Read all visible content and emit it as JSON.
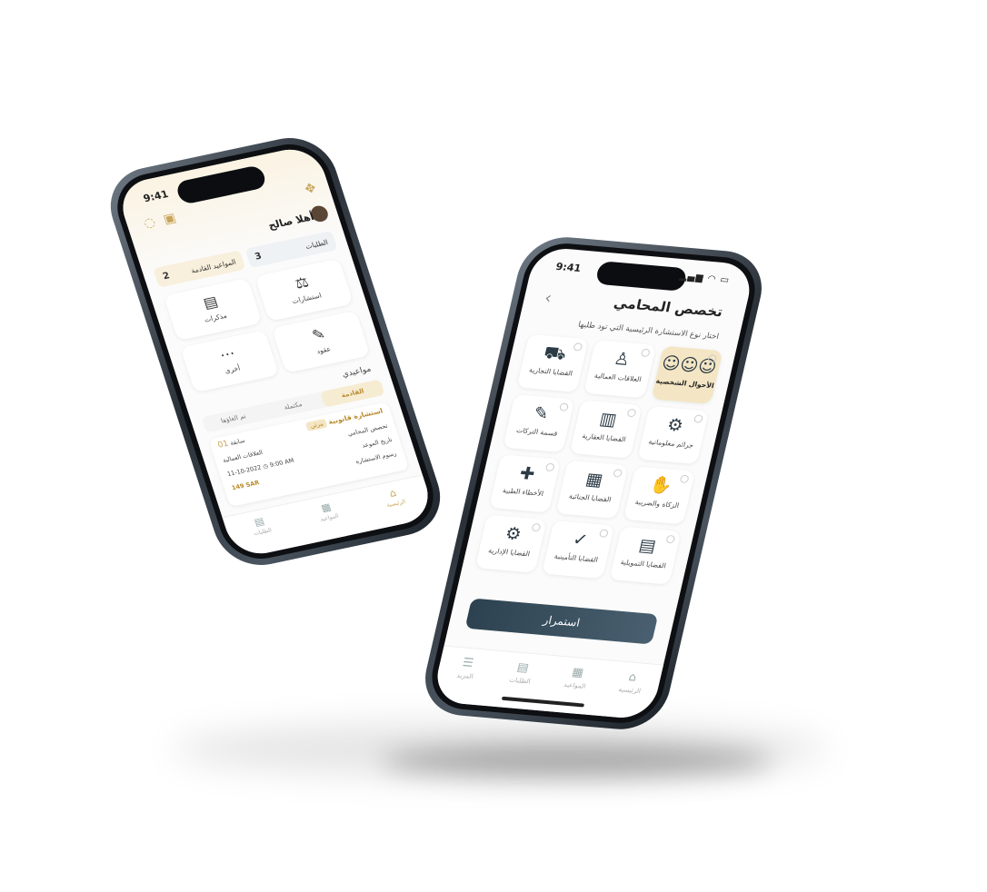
{
  "phone_b": {
    "time": "9:41",
    "status_icons": "▂▄▆ ◠ ▭",
    "title": "تخصص المحامي",
    "subtitle": "اختار نوع الاستشارة الرئيسية التي تود طلبها",
    "categories": [
      {
        "label": "الأحوال الشخصية",
        "selected": true,
        "icon": "family-icon"
      },
      {
        "label": "العلاقات العمالية",
        "selected": false,
        "icon": "worker-icon"
      },
      {
        "label": "القضايا التجارية",
        "selected": false,
        "icon": "commerce-icon"
      },
      {
        "label": "جرائم معلوماتية",
        "selected": false,
        "icon": "cyber-icon"
      },
      {
        "label": "القضايا العقارية",
        "selected": false,
        "icon": "building-icon"
      },
      {
        "label": "قسمة التركات",
        "selected": false,
        "icon": "document-icon"
      },
      {
        "label": "الزكاة والضريبة",
        "selected": false,
        "icon": "hand-coin-icon"
      },
      {
        "label": "القضايا الجنائية",
        "selected": false,
        "icon": "jail-icon"
      },
      {
        "label": "الأخطاء الطبية",
        "selected": false,
        "icon": "medical-icon"
      },
      {
        "label": "القضايا التمويلية",
        "selected": false,
        "icon": "finance-icon"
      },
      {
        "label": "القضايا التأمينية",
        "selected": false,
        "icon": "insurance-icon"
      },
      {
        "label": "القضايا الإدارية",
        "selected": false,
        "icon": "admin-gear-icon"
      }
    ],
    "continue_label": "استمرار",
    "tabs": [
      {
        "label": "المزيد",
        "icon": "menu-icon"
      },
      {
        "label": "الطلبات",
        "icon": "orders-icon"
      },
      {
        "label": "المواعيد",
        "icon": "calendar-icon"
      },
      {
        "label": "الرئيسية",
        "icon": "home-icon"
      }
    ]
  },
  "phone_a": {
    "time": "9:41",
    "greeting": "أهلا صالح",
    "counters": [
      {
        "label": "الطلبات",
        "value": "3"
      },
      {
        "label": "المواعيد القادمة",
        "value": "2"
      }
    ],
    "services": [
      {
        "label": "استشارات",
        "icon": "consult-icon"
      },
      {
        "label": "مذكرات",
        "icon": "memo-icon"
      },
      {
        "label": "عقود",
        "icon": "contract-icon"
      },
      {
        "label": "أخرى",
        "icon": "more-icon"
      }
    ],
    "appointments_label": "مواعيدي",
    "segments": [
      "القادمة",
      "مكتملة",
      "تم الغاؤها"
    ],
    "card": {
      "title": "استشارة قانونية",
      "badge": "مرئي",
      "number": "01",
      "number_label": "سابقة",
      "specialty_label": "تخصص المحامي",
      "specialty_value": "العلاقات العمالية",
      "date_label": "تاريخ الموعد",
      "date_value": "11-10-2022",
      "time_value": "9:00 AM",
      "fee_label": "رسوم الاستشارة",
      "fee_value": "149 SAR"
    },
    "tabs": [
      {
        "label": "الطلبات",
        "icon": "orders-icon"
      },
      {
        "label": "المواعيد",
        "icon": "calendar-icon"
      },
      {
        "label": "الرئيسية",
        "icon": "home-icon"
      }
    ]
  }
}
